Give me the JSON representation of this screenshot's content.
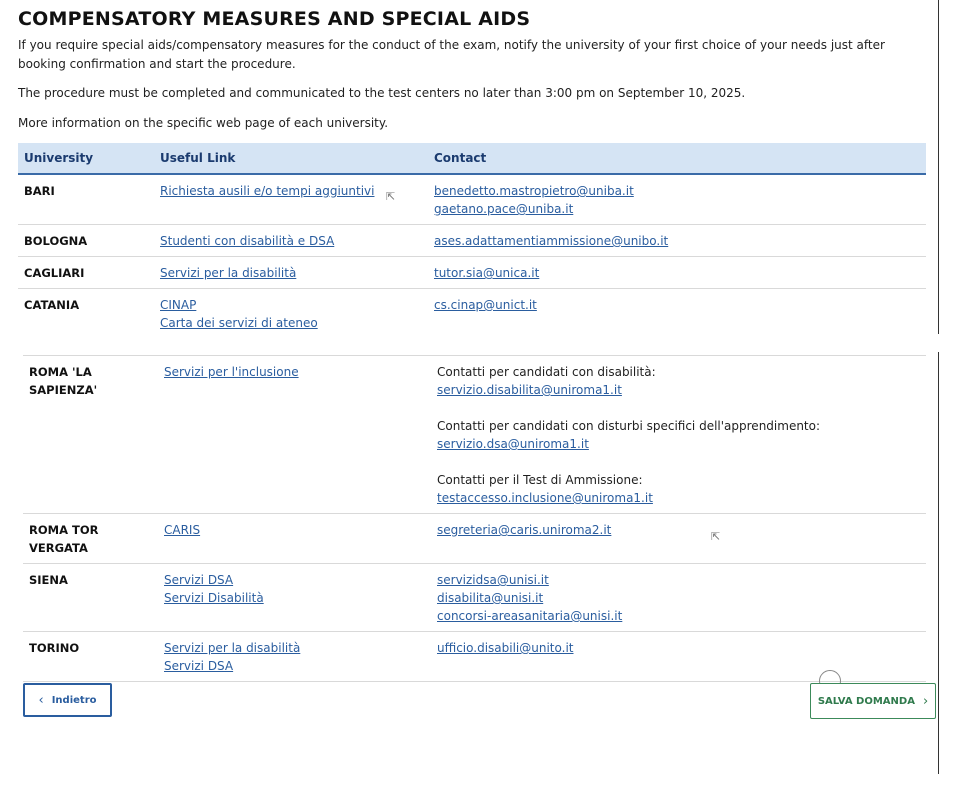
{
  "header": {
    "title": "COMPENSATORY MEASURES AND SPECIAL AIDS",
    "intro": "If you require special aids/compensatory measures for the conduct of the exam, notify the university of your first choice of your needs just after booking confirmation and start the procedure.",
    "deadline": "The procedure must be completed and communicated to the test centers no later than 3:00 pm on September 10, 2025.",
    "more_info": "More information on the specific web page of each university."
  },
  "table": {
    "headers": [
      "University",
      "Useful Link",
      "Contact"
    ],
    "rows_top": [
      {
        "university": "BARI",
        "links": [
          "Richiesta ausili e/o tempi aggiuntivi"
        ],
        "contacts": [
          "benedetto.mastropietro@uniba.it",
          "gaetano.pace@uniba.it"
        ]
      },
      {
        "university": "BOLOGNA",
        "links": [
          "Studenti con disabilità e DSA"
        ],
        "contacts": [
          "ases.adattamentiammissione@unibo.it"
        ]
      },
      {
        "university": "CAGLIARI",
        "links": [
          "Servizi per la disabilità"
        ],
        "contacts": [
          "tutor.sia@unica.it"
        ]
      },
      {
        "university": "CATANIA",
        "links": [
          "CINAP",
          "Carta dei servizi di ateneo"
        ],
        "contacts": [
          "cs.cinap@unict.it"
        ]
      }
    ],
    "rows_bottom": [
      {
        "university": "ROMA 'LA SAPIENZA'",
        "links": [
          "Servizi per l'inclusione"
        ],
        "contact_groups": [
          {
            "label": "Contatti per candidati con disabilità:",
            "email": "servizio.disabilita@uniroma1.it"
          },
          {
            "label": "Contatti per candidati con disturbi specifici dell'apprendimento:",
            "email": "servizio.dsa@uniroma1.it"
          },
          {
            "label": "Contatti per il Test di Ammissione:",
            "email": "testaccesso.inclusione@uniroma1.it"
          }
        ]
      },
      {
        "university": "ROMA TOR VERGATA",
        "links": [
          "CARIS"
        ],
        "contacts": [
          "segreteria@caris.uniroma2.it"
        ]
      },
      {
        "university": "SIENA",
        "links": [
          "Servizi DSA",
          "Servizi Disabilità"
        ],
        "contacts": [
          "servizidsa@unisi.it",
          "disabilita@unisi.it",
          "concorsi-areasanitaria@unisi.it"
        ]
      },
      {
        "university": "TORINO",
        "links": [
          "Servizi per la disabilità",
          "Servizi DSA"
        ],
        "contacts": [
          "ufficio.disabili@unito.it"
        ]
      }
    ]
  },
  "footer": {
    "back_label": "Indietro",
    "save_label": "SALVA DOMANDA"
  },
  "icons": {
    "back": "chevron-left-icon",
    "save": "chevron-right-icon"
  },
  "colors": {
    "link": "#2a5d9f",
    "header_bg": "#d5e4f4",
    "save_green": "#2f7a4c"
  }
}
